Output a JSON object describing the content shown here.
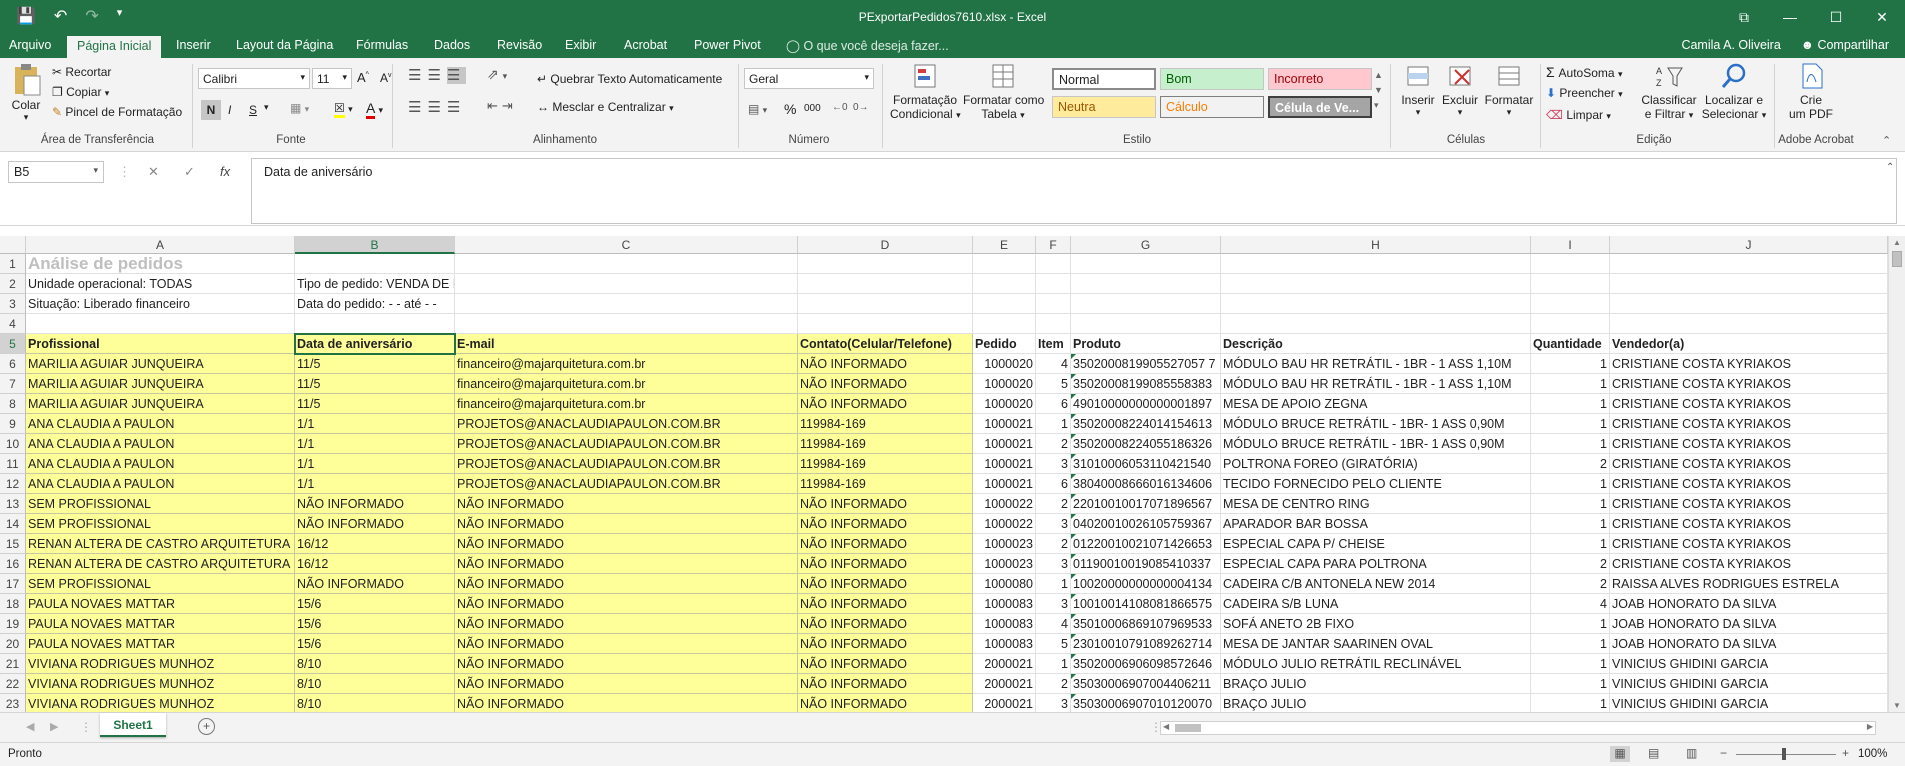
{
  "window": {
    "title": "PExportarPedidos7610.xlsx - Excel",
    "controls": [
      "⧉",
      "—",
      "☐",
      "✕"
    ]
  },
  "menu": {
    "file": "Arquivo",
    "tabs": [
      "Página Inicial",
      "Inserir",
      "Layout da Página",
      "Fórmulas",
      "Dados",
      "Revisão",
      "Exibir",
      "Acrobat",
      "Power Pivot"
    ],
    "tell_me": "O que você deseja fazer...",
    "user": "Camila A. Oliveira",
    "share": "Compartilhar"
  },
  "ribbon": {
    "clipboard": {
      "paste": "Colar",
      "cut": "Recortar",
      "copy": "Copiar",
      "format_painter": "Pincel de Formatação",
      "group": "Área de Transferência"
    },
    "font": {
      "name": "Calibri",
      "size": "11",
      "bold": "N",
      "italic": "I",
      "underline": "S",
      "group": "Fonte"
    },
    "alignment": {
      "wrap": "Quebrar Texto Automaticamente",
      "merge": "Mesclar e Centralizar",
      "group": "Alinhamento"
    },
    "number": {
      "format": "Geral",
      "group": "Número",
      "percent": "%",
      "thousands": "000"
    },
    "styles": {
      "conditional": [
        "Formatação",
        "Condicional"
      ],
      "as_table": [
        "Formatar como",
        "Tabela"
      ],
      "normal": "Normal",
      "good": "Bom",
      "bad": "Incorreto",
      "neutral": "Neutra",
      "calc": "Cálculo",
      "check": "Célula de Ve...",
      "group": "Estilo"
    },
    "cells": {
      "insert": "Inserir",
      "delete": "Excluir",
      "format": "Formatar",
      "group": "Células"
    },
    "editing": {
      "autosum": "AutoSoma",
      "fill": "Preencher",
      "clear": "Limpar",
      "sort": [
        "Classificar",
        "e Filtrar"
      ],
      "find": [
        "Localizar e",
        "Selecionar"
      ],
      "group": "Edição"
    },
    "acrobat": {
      "create": [
        "Crie",
        "um PDF"
      ],
      "group": "Adobe Acrobat"
    }
  },
  "formula_bar": {
    "name_box": "B5",
    "content": "Data de aniversário",
    "fx": "fx"
  },
  "columns": [
    "A",
    "B",
    "C",
    "D",
    "E",
    "F",
    "G",
    "H",
    "I",
    "J"
  ],
  "rows": [
    [
      "Análise de pedidos",
      "",
      "",
      "",
      "",
      "",
      "",
      "",
      "",
      ""
    ],
    [
      "Unidade operacional: TODAS",
      "Tipo de pedido: VENDA DE MERCADORIAS",
      "",
      "",
      "",
      "",
      "",
      "",
      "",
      ""
    ],
    [
      "Situação: Liberado financeiro",
      "Data do pedido:     - -   até     - -",
      "",
      "",
      "",
      "",
      "",
      "",
      "",
      ""
    ],
    [
      "",
      "",
      "",
      "",
      "",
      "",
      "",
      "",
      "",
      ""
    ],
    [
      "Profissional",
      "Data de aniversário",
      "E-mail",
      "Contato(Celular/Telefone)",
      "Pedido",
      "Item",
      "Produto",
      "Descrição",
      "Quantidade",
      "Vendedor(a)"
    ],
    [
      "MARILIA AGUIAR JUNQUEIRA",
      "11/5",
      "financeiro@majarquitetura.com.br",
      "NÃO INFORMADO",
      "1000020",
      "4",
      "3502000819905527057 7",
      "MÓDULO BAU HR RETRÁTIL - 1BR - 1 ASS 1,10M",
      "1",
      "CRISTIANE COSTA KYRIAKOS"
    ],
    [
      "MARILIA AGUIAR JUNQUEIRA",
      "11/5",
      "financeiro@majarquitetura.com.br",
      "NÃO INFORMADO",
      "1000020",
      "5",
      "35020008199085558383",
      "MÓDULO BAU HR RETRÁTIL - 1BR - 1 ASS 1,10M",
      "1",
      "CRISTIANE COSTA KYRIAKOS"
    ],
    [
      "MARILIA AGUIAR JUNQUEIRA",
      "11/5",
      "financeiro@majarquitetura.com.br",
      "NÃO INFORMADO",
      "1000020",
      "6",
      "49010000000000001897",
      "MESA DE APOIO ZEGNA",
      "1",
      "CRISTIANE COSTA KYRIAKOS"
    ],
    [
      "ANA CLAUDIA A PAULON",
      "1/1",
      "PROJETOS@ANACLAUDIAPAULON.COM.BR",
      "119984-169",
      "1000021",
      "1",
      "35020008224014154613",
      "MÓDULO BRUCE RETRÁTIL - 1BR- 1 ASS 0,90M",
      "1",
      "CRISTIANE COSTA KYRIAKOS"
    ],
    [
      "ANA CLAUDIA A PAULON",
      "1/1",
      "PROJETOS@ANACLAUDIAPAULON.COM.BR",
      "119984-169",
      "1000021",
      "2",
      "35020008224055186326",
      "MÓDULO BRUCE RETRÁTIL - 1BR- 1 ASS 0,90M",
      "1",
      "CRISTIANE COSTA KYRIAKOS"
    ],
    [
      "ANA CLAUDIA A PAULON",
      "1/1",
      "PROJETOS@ANACLAUDIAPAULON.COM.BR",
      "119984-169",
      "1000021",
      "3",
      "31010006053110421540",
      "POLTRONA FOREO (GIRATÓRIA)",
      "2",
      "CRISTIANE COSTA KYRIAKOS"
    ],
    [
      "ANA CLAUDIA A PAULON",
      "1/1",
      "PROJETOS@ANACLAUDIAPAULON.COM.BR",
      "119984-169",
      "1000021",
      "6",
      "38040008666016134606",
      "TECIDO FORNECIDO PELO CLIENTE",
      "1",
      "CRISTIANE COSTA KYRIAKOS"
    ],
    [
      "SEM PROFISSIONAL",
      "NÃO INFORMADO",
      "NÃO INFORMADO",
      "NÃO INFORMADO",
      "1000022",
      "2",
      "22010010017071896567",
      "MESA DE CENTRO RING",
      "1",
      "CRISTIANE COSTA KYRIAKOS"
    ],
    [
      "SEM PROFISSIONAL",
      "NÃO INFORMADO",
      "NÃO INFORMADO",
      "NÃO INFORMADO",
      "1000022",
      "3",
      "04020010026105759367",
      "APARADOR BAR BOSSA",
      "1",
      "CRISTIANE COSTA KYRIAKOS"
    ],
    [
      "RENAN ALTERA DE CASTRO ARQUITETURA",
      "16/12",
      "NÃO INFORMADO",
      "NÃO INFORMADO",
      "1000023",
      "2",
      "01220010021071426653",
      "ESPECIAL CAPA P/ CHEISE",
      "1",
      "CRISTIANE COSTA KYRIAKOS"
    ],
    [
      "RENAN ALTERA DE CASTRO ARQUITETURA",
      "16/12",
      "NÃO INFORMADO",
      "NÃO INFORMADO",
      "1000023",
      "3",
      "01190010019085410337",
      "ESPECIAL CAPA PARA POLTRONA",
      "2",
      "CRISTIANE COSTA KYRIAKOS"
    ],
    [
      "SEM PROFISSIONAL",
      "NÃO INFORMADO",
      "NÃO INFORMADO",
      "NÃO INFORMADO",
      "1000080",
      "1",
      "10020000000000004134",
      "CADEIRA C/B ANTONELA NEW 2014",
      "2",
      "RAISSA ALVES RODRIGUES ESTRELA"
    ],
    [
      "PAULA NOVAES MATTAR",
      "15/6",
      "NÃO INFORMADO",
      "NÃO INFORMADO",
      "1000083",
      "3",
      "10010014108081866575",
      "CADEIRA S/B LUNA",
      "4",
      "JOAB HONORATO DA SILVA"
    ],
    [
      "PAULA NOVAES MATTAR",
      "15/6",
      "NÃO INFORMADO",
      "NÃO INFORMADO",
      "1000083",
      "4",
      "35010006869107969533",
      "SOFÁ ANETO 2B FIXO",
      "1",
      "JOAB HONORATO DA SILVA"
    ],
    [
      "PAULA NOVAES MATTAR",
      "15/6",
      "NÃO INFORMADO",
      "NÃO INFORMADO",
      "1000083",
      "5",
      "23010010791089262714",
      "MESA DE JANTAR SAARINEN OVAL",
      "1",
      "JOAB HONORATO DA SILVA"
    ],
    [
      "VIVIANA RODRIGUES MUNHOZ",
      "8/10",
      "NÃO INFORMADO",
      "NÃO INFORMADO",
      "2000021",
      "1",
      "35020006906098572646",
      "MÓDULO JULIO RETRÁTIL RECLINÁVEL",
      "1",
      "VINICIUS GHIDINI GARCIA"
    ],
    [
      "VIVIANA RODRIGUES MUNHOZ",
      "8/10",
      "NÃO INFORMADO",
      "NÃO INFORMADO",
      "2000021",
      "2",
      "35030006907004406211",
      "BRAÇO JULIO",
      "1",
      "VINICIUS GHIDINI GARCIA"
    ],
    [
      "VIVIANA RODRIGUES MUNHOZ",
      "8/10",
      "NÃO INFORMADO",
      "NÃO INFORMADO",
      "2000021",
      "3",
      "35030006907010120070",
      "BRAÇO JULIO",
      "1",
      "VINICIUS GHIDINI GARCIA"
    ]
  ],
  "sheet": {
    "tab": "Sheet1",
    "add": "+"
  },
  "status": {
    "ready": "Pronto",
    "zoom": "100%"
  }
}
